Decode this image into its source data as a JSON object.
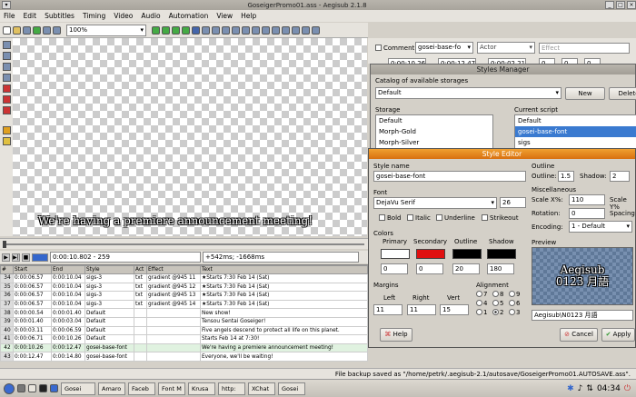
{
  "window": {
    "title": "GoseigerPromo01.ass - Aegisub 2.1.8"
  },
  "menu": [
    "File",
    "Edit",
    "Subtitles",
    "Timing",
    "Video",
    "Audio",
    "Automation",
    "View",
    "Help"
  ],
  "toolbar": {
    "zoom": "100%"
  },
  "video": {
    "subtitle": "We're having a premiere announcement meeting!"
  },
  "playback": {
    "time": "0:00:10.802 - 259",
    "offset": "+542ms; -1668ms"
  },
  "grid": {
    "headers": [
      "#",
      "Start",
      "End",
      "Style",
      "Act",
      "Effect",
      "Text"
    ],
    "rows": [
      [
        "34",
        "0:00:06.57",
        "0:00:10.04",
        "sigs-3",
        "txt",
        "gradient @945 11",
        "★Starts 7:30 Feb 14 (Sat)"
      ],
      [
        "35",
        "0:00:06.57",
        "0:00:10.04",
        "sigs-3",
        "txt",
        "gradient @945 12",
        "★Starts 7:30 Feb 14 (Sat)"
      ],
      [
        "36",
        "0:00:06.57",
        "0:00:10.04",
        "sigs-3",
        "txt",
        "gradient @945 13",
        "★Starts 7:30 Feb 14 (Sat)"
      ],
      [
        "37",
        "0:00:06.57",
        "0:00:10.04",
        "sigs-3",
        "txt",
        "gradient @945 14",
        "★Starts 7:30 Feb 14 (Sat)"
      ],
      [
        "38",
        "0:00:00.54",
        "0:00:01.40",
        "Default",
        "",
        "",
        "New show!"
      ],
      [
        "39",
        "0:00:01.40",
        "0:00:03.04",
        "Default",
        "",
        "",
        "Tensou Sentai Goseiger!"
      ],
      [
        "40",
        "0:00:03.11",
        "0:00:06.59",
        "Default",
        "",
        "",
        "Five angels descend to protect all life on this planet."
      ],
      [
        "41",
        "0:00:06.71",
        "0:00:10.26",
        "Default",
        "",
        "",
        "Starts Feb 14 at 7:30!"
      ],
      [
        "42",
        "0:00:10.26",
        "0:00:12.47",
        "gosei-base-font",
        "",
        "",
        "We're having a premiere announcement meeting!"
      ],
      [
        "43",
        "0:00:12.47",
        "0:00:14.80",
        "gosei-base-font",
        "",
        "",
        "Everyone, we'll be waiting!"
      ]
    ]
  },
  "editbar": {
    "comment": "Comment",
    "style": "gosei-base-fo",
    "actor": "Actor",
    "effect": "Effect",
    "start": "0:00:10.26",
    "end": "0:00:12.47",
    "dur": "0:00:02.21",
    "l": "0",
    "r": "0",
    "v": "0"
  },
  "styles_manager": {
    "title": "Styles Manager",
    "catalog_label": "Catalog of available storages",
    "catalog_value": "Default",
    "new_btn": "New",
    "delete_btn": "Delete",
    "storage_label": "Storage",
    "storage_items": [
      "Default",
      "Morph-Gold",
      "Morph-Silver"
    ],
    "current_label": "Current script",
    "current_items": [
      "Default",
      "gosei-base-font",
      "sigs"
    ]
  },
  "style_editor": {
    "title": "Style Editor",
    "style_name_label": "Style name",
    "style_name": "gosei-base-font",
    "font_label": "Font",
    "font_name": "DejaVu Serif",
    "font_size": "26",
    "bold": "Bold",
    "italic": "Italic",
    "underline": "Underline",
    "strikeout": "Strikeout",
    "colors_label": "Colors",
    "primary": "Primary",
    "secondary": "Secondary",
    "outline": "Outline",
    "shadow": "Shadow",
    "primary_color": "#ffffff",
    "secondary_color": "#e01010",
    "outline_color": "#000000",
    "shadow_color": "#000000",
    "alpha": [
      "0",
      "0",
      "20",
      "180"
    ],
    "margins_label": "Margins",
    "left": "Left",
    "right": "Right",
    "vert": "Vert",
    "margin_values": [
      "11",
      "11",
      "15"
    ],
    "alignment_label": "Alignment",
    "align_options": [
      "7",
      "8",
      "9",
      "4",
      "5",
      "6",
      "1",
      "2",
      "3"
    ],
    "align_selected": "2",
    "outline_group": "Outline",
    "outline_label": "Outline:",
    "outline_value": "1.5",
    "shadow_label": "Shadow:",
    "shadow_value": "2",
    "misc_label": "Miscellaneous",
    "scalex_label": "Scale X%:",
    "scalex_value": "110",
    "scaley_label": "Scale Y%",
    "rotation_label": "Rotation:",
    "rotation_value": "0",
    "spacing_label": "Spacing",
    "encoding_label": "Encoding:",
    "encoding_value": "1 - Default",
    "preview_label": "Preview",
    "preview_line1": "Aegisub",
    "preview_line2": "0123 月語",
    "preview_text": "Aegisub\\N0123 月語",
    "help_btn": "Help",
    "cancel_btn": "Cancel",
    "apply_btn": "Apply"
  },
  "status": "File backup saved as \"/home/petrk/.aegisub-2.1/autosave/GoseigerPromo01.AUTOSAVE.ass\".",
  "taskbar": {
    "tasks": [
      "Gosei",
      "Amaro",
      "Faceb",
      "Font M",
      "Krusa",
      "http:",
      "XChat",
      "Gosei"
    ],
    "clock": "04:34"
  }
}
